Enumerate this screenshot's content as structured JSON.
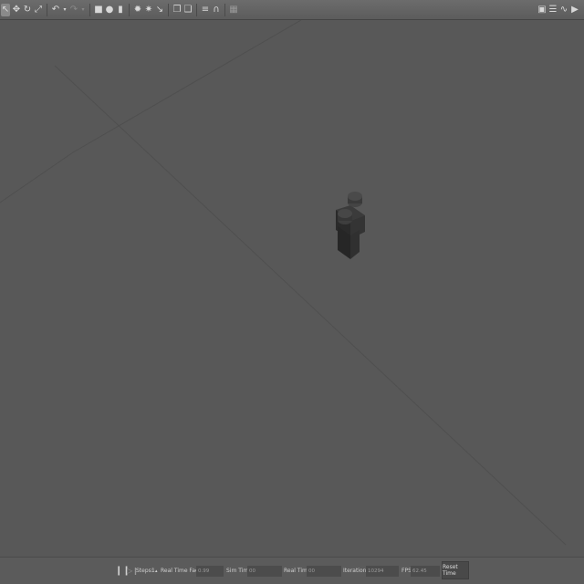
{
  "toolbar": {
    "left_tools": [
      "select-arrow-icon",
      "translate-icon",
      "rotate-icon",
      "scale-icon",
      "undo-icon",
      "undo-dropdown-icon",
      "redo-icon",
      "redo-dropdown-icon",
      "box-icon",
      "sphere-icon",
      "cylinder-icon",
      "point-light-icon",
      "spot-light-icon",
      "directional-light-icon",
      "copy-icon",
      "paste-icon",
      "align-icon",
      "snap-icon",
      "screenshot-icon"
    ],
    "right_tools": [
      "screenshot-icon",
      "log-icon",
      "plot-icon",
      "video-record-icon"
    ]
  },
  "status": {
    "steps_label": "Steps:",
    "steps_value": "1",
    "rtf_label": "Real Time Factor:",
    "rtf_value": "0.99",
    "sim_label": "Sim Time:",
    "sim_value": "00 00:00:10.294",
    "real_label": "Real Time:",
    "real_value": "00 00:00:10.360",
    "iter_label": "Iterations:",
    "iter_value": "10294",
    "fps_label": "FPS:",
    "fps_value": "62.45",
    "reset_label": "Reset Time"
  },
  "colors": {
    "background": "#575757",
    "grid": "#4e4e4e",
    "brick": "#2f2f2f"
  }
}
